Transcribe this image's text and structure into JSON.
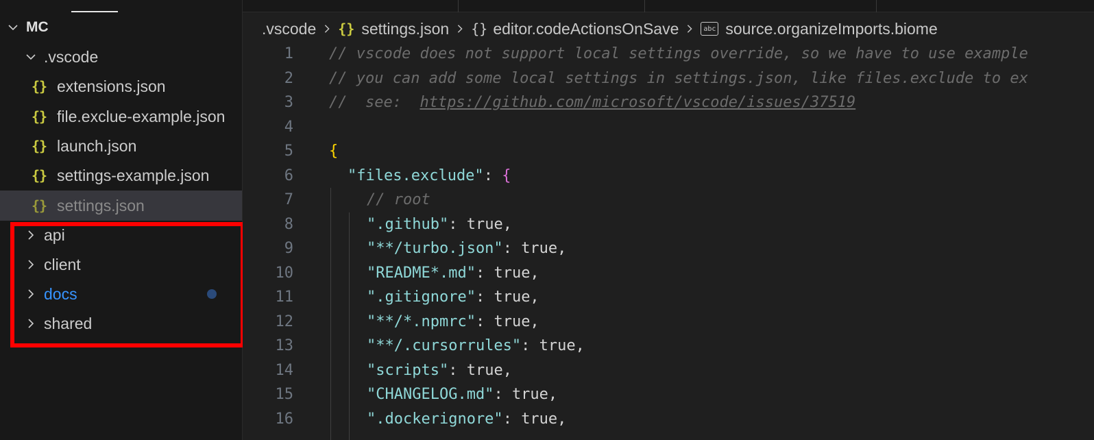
{
  "explorer": {
    "root_label": "MC",
    "items": [
      {
        "type": "folder-open",
        "label": ".vscode"
      },
      {
        "type": "json",
        "label": "extensions.json"
      },
      {
        "type": "json",
        "label": "file.exclue-example.json"
      },
      {
        "type": "json",
        "label": "launch.json"
      },
      {
        "type": "json",
        "label": "settings-example.json"
      },
      {
        "type": "json",
        "label": "settings.json",
        "selected": true
      },
      {
        "type": "folder",
        "label": "api"
      },
      {
        "type": "folder",
        "label": "client"
      },
      {
        "type": "folder",
        "label": "docs",
        "modified": true
      },
      {
        "type": "folder",
        "label": "shared"
      }
    ],
    "json_icon": "{}"
  },
  "breadcrumb": {
    "folder": ".vscode",
    "file_icon": "{}",
    "file": "settings.json",
    "object_icon": "{}",
    "object": "editor.codeActionsOnSave",
    "string_icon": "abc",
    "string": "source.organizeImports.biome"
  },
  "code": {
    "line_numbers": [
      "1",
      "2",
      "3",
      "4",
      "5",
      "6",
      "7",
      "8",
      "9",
      "10",
      "11",
      "12",
      "13",
      "14",
      "15",
      "16"
    ],
    "line1": "// vscode does not support local settings override, so we have to use example",
    "line2": "// you can add some local settings in settings.json, like files.exclude to ex",
    "line3_prefix": "//  see:  ",
    "line3_link": "https://github.com/microsoft/vscode/issues/37519",
    "line5": "{",
    "line6_key": "\"files.exclude\"",
    "line6_rest": ": ",
    "line6_brace": "{",
    "line7": "// root",
    "entries": [
      {
        "key": "\".github\"",
        "value": "true,"
      },
      {
        "key": "\"**/turbo.json\"",
        "value": "true,"
      },
      {
        "key": "\"README*.md\"",
        "value": "true,"
      },
      {
        "key": "\".gitignore\"",
        "value": "true,"
      },
      {
        "key": "\"**/*.npmrc\"",
        "value": "true,"
      },
      {
        "key": "\"**/.cursorrules\"",
        "value": "true,"
      },
      {
        "key": "\"scripts\"",
        "value": "true,"
      },
      {
        "key": "\"CHANGELOG.md\"",
        "value": "true,"
      },
      {
        "key": "\".dockerignore\"",
        "value": "true,"
      }
    ]
  },
  "colors": {
    "highlight": "#ff0000",
    "json_icon": "#cbcb41",
    "modified": "#3794ff"
  }
}
